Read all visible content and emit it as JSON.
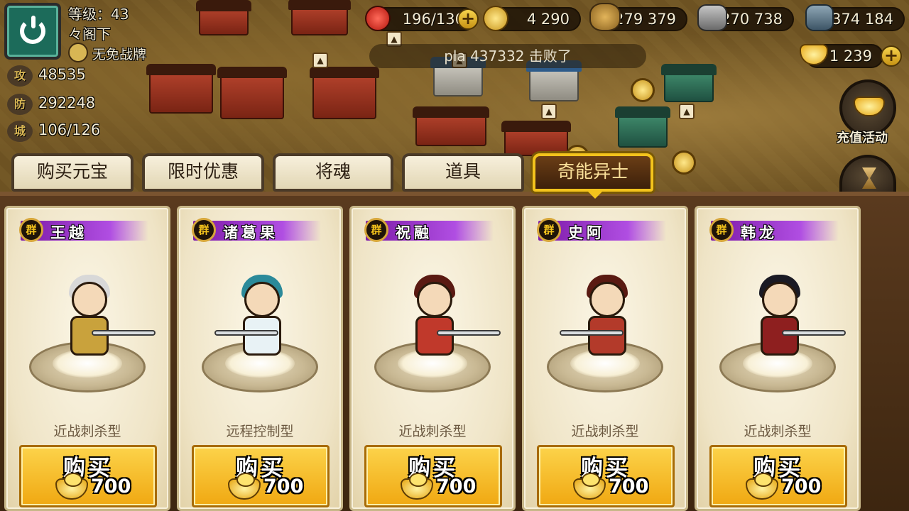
{
  "player": {
    "level_label": "等级：43",
    "name": "々阁下",
    "status": "无免战牌",
    "stats": [
      {
        "badge": "攻",
        "value": "48535"
      },
      {
        "badge": "防",
        "value": "292248"
      },
      {
        "badge": "城",
        "value": "106/126"
      }
    ]
  },
  "resources": {
    "troops": "196/136",
    "copper": "4 290",
    "food": "279 379",
    "stone": "270 738",
    "iron": "374 184",
    "gold_ingot": "1 239"
  },
  "ticker": "pla 437332 击败了",
  "side_button_label": "充值活动",
  "tabs": [
    {
      "label": "购买元宝",
      "active": false
    },
    {
      "label": "限时优惠",
      "active": false
    },
    {
      "label": "将魂",
      "active": false
    },
    {
      "label": "道具",
      "active": false
    },
    {
      "label": "奇能异士",
      "active": true
    }
  ],
  "heroes": [
    {
      "faction": "群",
      "name": "王越",
      "role": "近战刺杀型",
      "buy_label": "购买",
      "price": "700",
      "hair": "#d8d8d8",
      "outfit": "#c9a23c"
    },
    {
      "faction": "群",
      "name": "诸葛果",
      "role": "远程控制型",
      "buy_label": "购买",
      "price": "700",
      "hair": "#2b8a9a",
      "outfit": "#e8f2f5"
    },
    {
      "faction": "群",
      "name": "祝融",
      "role": "近战刺杀型",
      "buy_label": "购买",
      "price": "700",
      "hair": "#5a1a12",
      "outfit": "#c0392b"
    },
    {
      "faction": "群",
      "name": "史阿",
      "role": "近战刺杀型",
      "buy_label": "购买",
      "price": "700",
      "hair": "#5a1a12",
      "outfit": "#b33a2a"
    },
    {
      "faction": "群",
      "name": "韩龙",
      "role": "近战刺杀型",
      "buy_label": "购买",
      "price": "700",
      "hair": "#1a1a24",
      "outfit": "#8e1f1f"
    }
  ]
}
